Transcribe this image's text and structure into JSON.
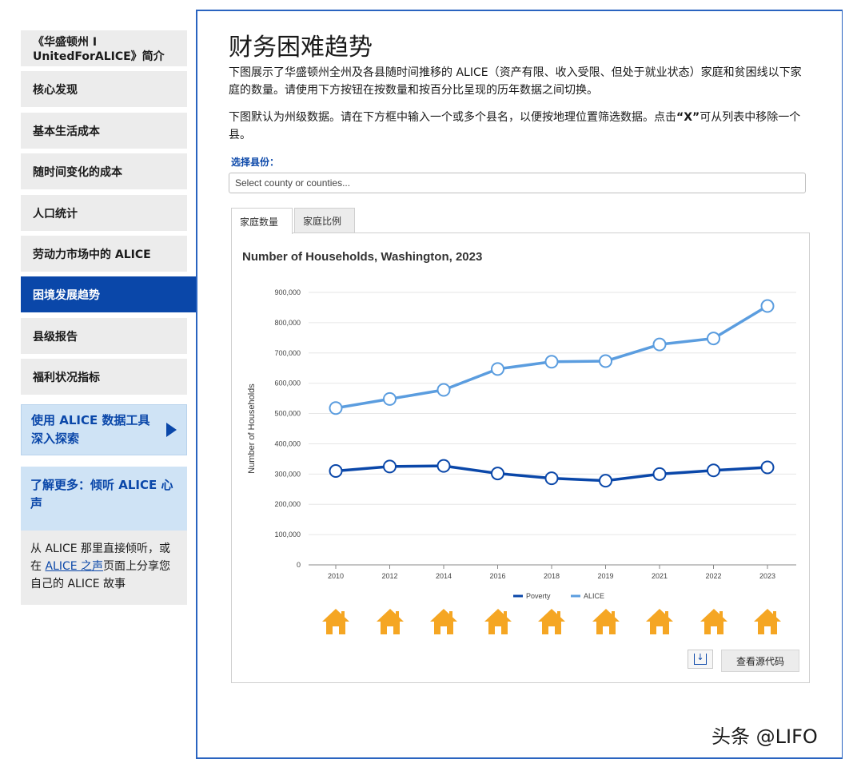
{
  "sidebar": {
    "items": [
      {
        "label_line1": "《华盛顿州 I",
        "label_line2": "UnitedForALICE》简介"
      },
      {
        "label": "核心发现"
      },
      {
        "label": "基本生活成本"
      },
      {
        "label": "随时间变化的成本"
      },
      {
        "label": "人口统计"
      },
      {
        "label": "劳动力市场中的 ALICE"
      },
      {
        "label": "困境发展趋势",
        "active": true
      },
      {
        "label": "县级报告"
      },
      {
        "label": "福利状况指标"
      }
    ],
    "explore": {
      "label": "使用 ALICE 数据工具深入探索",
      "icon": "play-arrow-icon"
    },
    "learn": {
      "heading": "了解更多：倾听 ALICE 心声",
      "body_prefix": "从 ALICE 那里直接倾听，或在 ",
      "link": "ALICE 之声",
      "body_suffix": "页面上分享您自己的 ALICE 故事"
    }
  },
  "main": {
    "title": "财务困难趋势",
    "para1": "下图展示了华盛顿州全州及各县随时间推移的 ALICE（资产有限、收入受限、但处于就业状态）家庭和贫困线以下家庭的数量。请使用下方按钮在按数量和按百分比呈现的历年数据之间切换。",
    "para2_prefix": "下图默认为州级数据。请在下方框中输入一个或多个县名，以便按地理位置筛选数据。点击",
    "para2_bold": "“X”",
    "para2_suffix": "可从列表中移除一个县。",
    "select_label": "选择县份：",
    "select_placeholder": "Select county or counties...",
    "tabs": [
      "家庭数量",
      "家庭比例"
    ],
    "download_icon": "download-icon",
    "source_button": "查看源代码"
  },
  "colors": {
    "poverty": "#0a47a9",
    "alice": "#5b9ddf",
    "house": "#f5a623",
    "accent": "#0a47a9"
  },
  "chart_data": {
    "type": "line",
    "title": "Number of Households, Washington, 2023",
    "ylabel": "Number of Households",
    "xlabel": "",
    "categories": [
      "2010",
      "2012",
      "2014",
      "2016",
      "2018",
      "2019",
      "2021",
      "2022",
      "2023"
    ],
    "ylim": [
      0,
      900000
    ],
    "yticks": [
      "0",
      "100,000",
      "200,000",
      "300,000",
      "400,000",
      "500,000",
      "600,000",
      "700,000",
      "800,000",
      "900,000"
    ],
    "series": [
      {
        "name": "Poverty",
        "values": [
          310000,
          325000,
          327000,
          302000,
          286000,
          278000,
          300000,
          312000,
          322000
        ]
      },
      {
        "name": "ALICE",
        "values": [
          518000,
          548000,
          578000,
          647000,
          671000,
          673000,
          728000,
          748000,
          855000
        ]
      }
    ],
    "grid": true,
    "legend": "bottom"
  },
  "watermark": "头条 @LIFO"
}
